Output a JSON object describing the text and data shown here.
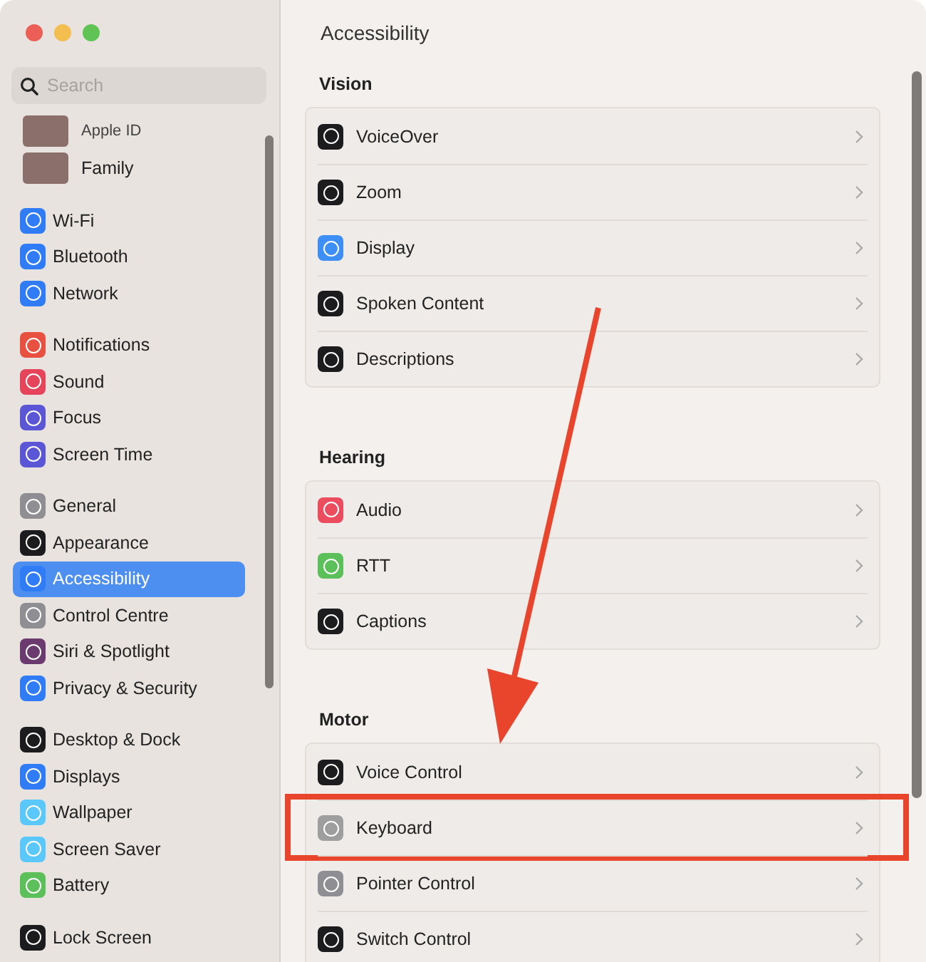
{
  "window": {
    "title": "Accessibility"
  },
  "sidebar": {
    "search": {
      "placeholder": "Search"
    },
    "account": [
      {
        "label": "Apple ID"
      },
      {
        "label": "Family"
      }
    ],
    "groups": [
      {
        "items": [
          {
            "label": "Wi-Fi",
            "color": "#2f7cf6",
            "selected": false
          },
          {
            "label": "Bluetooth",
            "color": "#2f7cf6",
            "selected": false
          },
          {
            "label": "Network",
            "color": "#2f7cf6",
            "selected": false
          }
        ]
      },
      {
        "items": [
          {
            "label": "Notifications",
            "color": "#e8503f",
            "selected": false
          },
          {
            "label": "Sound",
            "color": "#e5445a",
            "selected": false
          },
          {
            "label": "Focus",
            "color": "#5a56d6",
            "selected": false
          },
          {
            "label": "Screen Time",
            "color": "#5a56d6",
            "selected": false
          }
        ]
      },
      {
        "items": [
          {
            "label": "General",
            "color": "#8e8e93",
            "selected": false
          },
          {
            "label": "Appearance",
            "color": "#1c1c1e",
            "selected": false
          },
          {
            "label": "Accessibility",
            "color": "#2f7cf6",
            "selected": true
          },
          {
            "label": "Control Centre",
            "color": "#8e8e93",
            "selected": false
          },
          {
            "label": "Siri & Spotlight",
            "color": "#6b3a6e",
            "selected": false
          },
          {
            "label": "Privacy & Security",
            "color": "#2f7cf6",
            "selected": false
          }
        ]
      },
      {
        "items": [
          {
            "label": "Desktop & Dock",
            "color": "#1c1c1e",
            "selected": false
          },
          {
            "label": "Displays",
            "color": "#2f7cf6",
            "selected": false
          },
          {
            "label": "Wallpaper",
            "color": "#5ac8fa",
            "selected": false
          },
          {
            "label": "Screen Saver",
            "color": "#5ac8fa",
            "selected": false
          },
          {
            "label": "Battery",
            "color": "#5cc05a",
            "selected": false
          }
        ]
      },
      {
        "items": [
          {
            "label": "Lock Screen",
            "color": "#1c1c1e",
            "selected": false
          }
        ]
      }
    ]
  },
  "sections": [
    {
      "title": "Vision",
      "rows": [
        {
          "label": "VoiceOver",
          "color": "#1c1c1e",
          "highlighted": false
        },
        {
          "label": "Zoom",
          "color": "#1c1c1e",
          "highlighted": false
        },
        {
          "label": "Display",
          "color": "#3d8ef5",
          "highlighted": false
        },
        {
          "label": "Spoken Content",
          "color": "#1c1c1e",
          "highlighted": false
        },
        {
          "label": "Descriptions",
          "color": "#1c1c1e",
          "highlighted": false
        }
      ]
    },
    {
      "title": "Hearing",
      "rows": [
        {
          "label": "Audio",
          "color": "#ec4d5e",
          "highlighted": false
        },
        {
          "label": "RTT",
          "color": "#5cc05a",
          "highlighted": false
        },
        {
          "label": "Captions",
          "color": "#1c1c1e",
          "highlighted": false
        }
      ]
    },
    {
      "title": "Motor",
      "rows": [
        {
          "label": "Voice Control",
          "color": "#1c1c1e",
          "highlighted": false
        },
        {
          "label": "Keyboard",
          "color": "#9e9e9e",
          "highlighted": true
        },
        {
          "label": "Pointer Control",
          "color": "#8e8e93",
          "highlighted": false
        },
        {
          "label": "Switch Control",
          "color": "#1c1c1e",
          "highlighted": false
        }
      ]
    }
  ]
}
